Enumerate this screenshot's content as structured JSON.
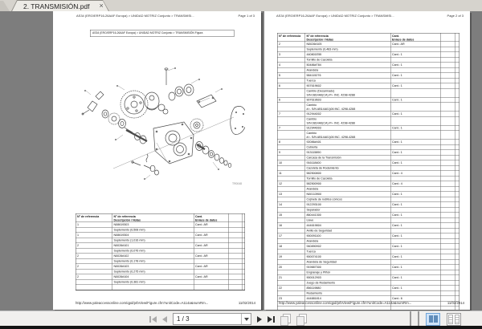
{
  "tab": {
    "title": "2. TRANSMISIÓN.pdf",
    "close_label": "×"
  },
  "table_headers": {
    "ref": "Nº de referencia",
    "part1": "Nº de referencia",
    "part2": "Descripción / Notas",
    "qty1": "Cant.",
    "qty2": "Enlace de datos"
  },
  "pages": {
    "left": {
      "breadcrumb": "AS34 (ERO/ERP16-26AAF Europa) > UNIDAD MOTRIZ Conjunto > TRANSMISI...",
      "page_label": "Page 1 of 3",
      "figure_title": "AS34 (ERO/ERP16-26AAF Europa) > UNIDAD MOTRIZ Conjunto > TRANSMISIÓN Figura",
      "diagram_code": "TR0048",
      "entries": [
        {
          "ref": "1",
          "part": "N08619303",
          "desc": "Suplemento (0,508 mm)",
          "qty": "Cant.: AR"
        },
        {
          "ref": "1",
          "part": "N08619304",
          "desc": "Suplemento (1,016 mm)",
          "qty": "Cant.: AR"
        },
        {
          "ref": "2",
          "part": "N0026#101",
          "desc": "Suplemento (0,076 mm)",
          "qty": "Cant.: AR"
        },
        {
          "ref": "2",
          "part": "N0026#102",
          "desc": "Suplemento (0,178 mm)",
          "qty": "Cant.: AR"
        },
        {
          "ref": "2",
          "part": "N0026#103",
          "desc": "Suplemento (0,275 mm)",
          "qty": "Cant.: AR"
        },
        {
          "ref": "2",
          "part": "N0026#104",
          "desc": "Suplemento (0,381 mm)",
          "qty": "Cant.: AR"
        }
      ],
      "footer_url": "http://www.yaleaccessonline.com/qpd/prbView/Figure.cfm?unitCode=A114a&numRm...",
      "footer_date": "11/02/2014"
    },
    "right": {
      "breadcrumb": "AS34 (ERO/ERP16-26AAF Europa) > UNIDAD MOTRIZ Conjunto > TRANSMISI...",
      "page_label": "Page 2 of 3",
      "entries": [
        {
          "ref": "2",
          "part": "N0026#105",
          "desc": "Suplemento (0,483 mm)",
          "qty": "Cant.: AR"
        },
        {
          "ref": "3",
          "part": "440801E55",
          "desc": "Tornillo de Cazoleta",
          "qty": "Cant.: 1"
        },
        {
          "ref": "4",
          "part": "50486#784",
          "desc": "Arandela",
          "qty": "Cant.: 1"
        },
        {
          "ref": "5",
          "part": "584115276",
          "desc": "Tuerca",
          "qty": "Cant.: 1"
        },
        {
          "ref": "6",
          "part": "907619602",
          "desc": "Cambio (Desarmado)\nS/N 0814A0(CA) #>- INC. 4298-4288",
          "qty": "Cant.: 1"
        },
        {
          "ref": "6",
          "part": "907619603",
          "desc": "Cambio\n#>- S/N AB14A01)06 INC. 4298-4288",
          "qty": "Cant.: 1"
        },
        {
          "ref": "7",
          "part": "912944002",
          "desc": "Cambio\nS/N 0814A0(CA) #>- INC. 4298-4288",
          "qty": "Cant.: 1"
        },
        {
          "ref": "7",
          "part": "912944003",
          "desc": "Cambio\n#>- S/N AB14A01)06 INC. 4298-4288",
          "qty": "Cant.: 1"
        },
        {
          "ref": "8",
          "part": "92086#401",
          "desc": "Cubierta",
          "qty": "Cant.: 1"
        },
        {
          "ref": "9",
          "part": "913115890",
          "desc": "Carcasa de la Transmisión",
          "qty": "Cant.: 1"
        },
        {
          "ref": "10",
          "part": "916118400",
          "desc": "Cazoleta de Rodamiento",
          "qty": "Cant.: 1"
        },
        {
          "ref": "11",
          "part": "582500800",
          "desc": "Tornillo de Cazoleta",
          "qty": "Cant.: 4"
        },
        {
          "ref": "12",
          "part": "582500900",
          "desc": "Arandela",
          "qty": "Cant.: 4"
        },
        {
          "ref": "13",
          "part": "N00113900",
          "desc": "Cojinete de rodillos cónicos",
          "qty": "Cant.: 1"
        },
        {
          "ref": "14",
          "part": "912293100",
          "desc": "Separador",
          "qty": "Cant.: 1"
        },
        {
          "ref": "15",
          "part": "860441300",
          "desc": "Llave",
          "qty": "Cant.: 1"
        },
        {
          "ref": "16",
          "part": "444619804",
          "desc": "Anillo de Seguridad",
          "qty": "Cant.: 1"
        },
        {
          "ref": "17",
          "part": "900091100",
          "desc": "Arandela",
          "qty": "Cant.: 1"
        },
        {
          "ref": "18",
          "part": "940890902",
          "desc": "Tuerca",
          "qty": "Cant.: 1"
        },
        {
          "ref": "19",
          "part": "900074100",
          "desc": "Arandela de Seguridad",
          "qty": "Cant.: 1"
        },
        {
          "ref": "20",
          "part": "919887300",
          "desc": "Engranaje y Piñón",
          "qty": "Cant.: 1"
        },
        {
          "ref": "21",
          "part": "900012903",
          "desc": "Juego de Rodamiento",
          "qty": "Cant.: 1"
        },
        {
          "ref": "22",
          "part": "856119880",
          "desc": "Rodamiento",
          "qty": "Cant.: 1"
        },
        {
          "ref": "23",
          "part": "444881814",
          "desc": "",
          "qty": "Cant.: 6"
        }
      ],
      "footer_url": "http://www.yaleaccessonline.com/qpd/prbView/Figure.cfm?unitCode=A114a&numRm...",
      "footer_date": "11/02/2014"
    }
  },
  "toolbar": {
    "page_indicator": "1 / 3",
    "icons": {
      "first": "first-page-icon",
      "prev": "previous-page-icon",
      "next": "next-page-icon",
      "last": "last-page-icon",
      "prev_view": "previous-view-icon",
      "next_view": "next-view-icon",
      "views": [
        "single-page-icon",
        "continuous-icon",
        "two-up-icon",
        "two-up-continuous-icon"
      ],
      "active_view": "two-up-icon"
    },
    "accent_color": "#cfe3f8"
  }
}
